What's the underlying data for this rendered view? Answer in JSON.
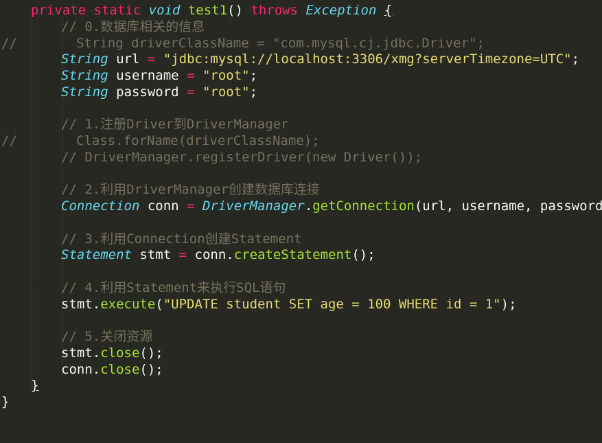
{
  "editor": {
    "theme_colors": {
      "background": "#272822",
      "keyword": "#f92672",
      "type": "#66d9ef",
      "function": "#a6e22e",
      "string": "#e6db74",
      "comment": "#75715e",
      "text": "#f8f8f2"
    },
    "lines": {
      "l1": {
        "kw1": "private",
        "kw2": "static",
        "type": "void",
        "name": "test1",
        "paren": "()",
        "throws": "throws",
        "exc": "Exception",
        "brace": "{"
      },
      "l2": {
        "comment": "// 0.数据库相关的信息"
      },
      "l3": {
        "gutter": "//",
        "comment": "String driverClassName = \"com.mysql.cj.jdbc.Driver\";"
      },
      "l4": {
        "type": "String",
        "var": "url",
        "eq": "=",
        "value": "\"jdbc:mysql://localhost:3306/xmg?serverTimezone=UTC\"",
        "semi": ";"
      },
      "l5": {
        "type": "String",
        "var": "username",
        "eq": "=",
        "value": "\"root\"",
        "semi": ";"
      },
      "l6": {
        "type": "String",
        "var": "password",
        "eq": "=",
        "value": "\"root\"",
        "semi": ";"
      },
      "l8": {
        "comment": "// 1.注册Driver到DriverManager"
      },
      "l9": {
        "gutter": "//",
        "comment": "Class.forName(driverClassName);"
      },
      "l10": {
        "comment": "// DriverManager.registerDriver(new Driver());"
      },
      "l12": {
        "comment": "// 2.利用DriverManager创建数据库连接"
      },
      "l13": {
        "type": "Connection",
        "var": "conn",
        "eq": "=",
        "cls": "DriverManager",
        "dot": ".",
        "method": "getConnection",
        "args": "(url, username, password);"
      },
      "l15": {
        "comment": "// 3.利用Connection创建Statement"
      },
      "l16": {
        "type": "Statement",
        "var": "stmt",
        "eq": "=",
        "obj": "conn.",
        "method": "createStatement",
        "args": "();"
      },
      "l18": {
        "comment": "// 4.利用Statement来执行SQL语句"
      },
      "l19": {
        "obj": "stmt.",
        "method": "execute",
        "open": "(",
        "value": "\"UPDATE student SET age = 100 WHERE id = 1\"",
        "close": ");"
      },
      "l21": {
        "comment": "// 5.关闭资源"
      },
      "l22": {
        "obj": "stmt.",
        "method": "close",
        "args": "();"
      },
      "l23": {
        "obj": "conn.",
        "method": "close",
        "args": "();"
      },
      "l24": {
        "brace": "}"
      },
      "l25": {
        "brace": "}"
      }
    }
  }
}
